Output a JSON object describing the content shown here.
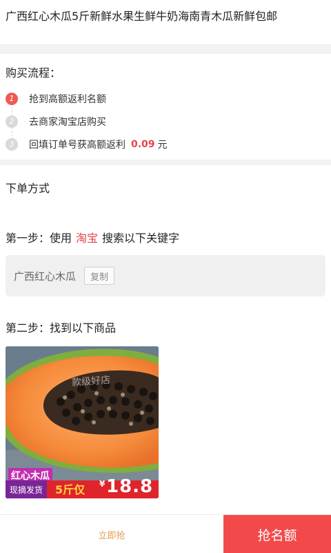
{
  "product": {
    "title": "广西红心木瓜5斤新鲜水果生鲜牛奶海南青木瓜新鲜包邮"
  },
  "purchase_flow": {
    "heading": "购买流程：",
    "steps": [
      {
        "num": "1",
        "text": "抢到高额返利名额"
      },
      {
        "num": "2",
        "text": "去商家淘宝店购买"
      },
      {
        "num": "3",
        "text": "回填订单号获高额返利",
        "amount": "0.09",
        "unit": "元"
      }
    ]
  },
  "order_method": {
    "heading": "下单方式",
    "step1_prefix": "第一步：使用",
    "step1_platform": "淘宝",
    "step1_suffix": "搜索以下关键字",
    "keyword": "广西红心木瓜",
    "copy_label": "复制",
    "step2": "第二步：找到以下商品"
  },
  "product_image": {
    "name_badge": "红心木瓜",
    "shipping": "现摘发货",
    "weight": "5斤仅",
    "currency": "¥",
    "price": "18.8",
    "watermark": "款级好店"
  },
  "bottom_bar": {
    "now_label": "立即抢",
    "grab_label": "抢名额"
  },
  "colors": {
    "accent": "#e5434b",
    "button": "#f24a4a",
    "now_text": "#e29b4a"
  }
}
